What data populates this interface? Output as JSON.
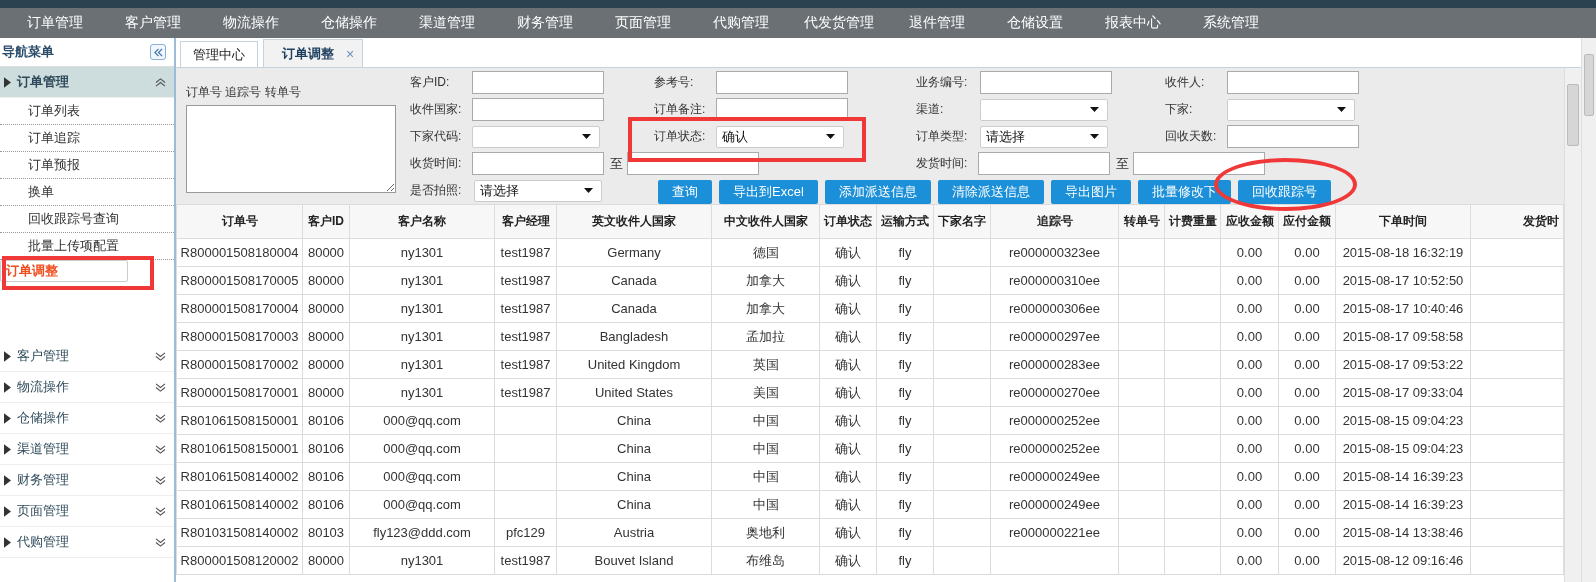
{
  "top_menu": [
    {
      "label": "订单管理"
    },
    {
      "label": "客户管理"
    },
    {
      "label": "物流操作"
    },
    {
      "label": "仓储操作"
    },
    {
      "label": "渠道管理"
    },
    {
      "label": "财务管理"
    },
    {
      "label": "页面管理"
    },
    {
      "label": "代购管理"
    },
    {
      "label": "代发货管理"
    },
    {
      "label": "退件管理"
    },
    {
      "label": "仓储设置"
    },
    {
      "label": "报表中心"
    },
    {
      "label": "系统管理"
    }
  ],
  "sidebar": {
    "title": "导航菜单",
    "groups": [
      {
        "label": "订单管理",
        "expanded": true,
        "children": [
          {
            "label": "订单列表",
            "selected": false
          },
          {
            "label": "订单追踪",
            "selected": false
          },
          {
            "label": "订单预报",
            "selected": false
          },
          {
            "label": "换单",
            "selected": false
          },
          {
            "label": "回收跟踪号查询",
            "selected": false
          },
          {
            "label": "批量上传项配置",
            "selected": false
          },
          {
            "label": "订单调整",
            "selected": true,
            "boxed": true
          }
        ]
      },
      {
        "label": "客户管理",
        "expanded": false
      },
      {
        "label": "物流操作",
        "expanded": false
      },
      {
        "label": "仓储操作",
        "expanded": false
      },
      {
        "label": "渠道管理",
        "expanded": false
      },
      {
        "label": "财务管理",
        "expanded": false
      },
      {
        "label": "页面管理",
        "expanded": false
      },
      {
        "label": "代购管理",
        "expanded": false
      }
    ]
  },
  "tabs": [
    {
      "label": "管理中心",
      "selected": false
    },
    {
      "label": "订单调整",
      "selected": true,
      "close": "×"
    }
  ],
  "filter": {
    "textarea_label": "订单号 追踪号 转单号",
    "fields": [
      {
        "kind": "input",
        "label": "客户ID:"
      },
      {
        "kind": "input",
        "label": "参考号:"
      },
      {
        "kind": "input",
        "label": "业务编号:"
      },
      {
        "kind": "input",
        "label": "收件人:"
      },
      {
        "kind": "input",
        "label": "收件国家:"
      },
      {
        "kind": "input",
        "label": "订单备注:"
      },
      {
        "kind": "select",
        "label": "渠道:"
      },
      {
        "kind": "select",
        "label": "下家:"
      },
      {
        "kind": "select",
        "label": "下家代码:"
      },
      {
        "kind": "select",
        "label": "订单状态:",
        "value": "确认",
        "boxed": true
      },
      {
        "kind": "select",
        "label": "订单类型:",
        "value": "请选择"
      },
      {
        "kind": "input",
        "label": "回收天数:"
      },
      {
        "kind": "range",
        "label": "收货时间:",
        "to": "至"
      },
      {
        "kind": "range",
        "label": "发货时间:",
        "to": "至"
      },
      {
        "kind": "select",
        "label": "是否拍照:",
        "value": "请选择"
      }
    ],
    "buttons": [
      {
        "label": "查询"
      },
      {
        "label": "导出到Excel"
      },
      {
        "label": "添加派送信息"
      },
      {
        "label": "清除派送信息"
      },
      {
        "label": "导出图片"
      },
      {
        "label": "批量修改下"
      },
      {
        "label": "回收跟踪号",
        "circled": true
      }
    ]
  },
  "table": {
    "columns": [
      "订单号",
      "客户ID",
      "客户名称",
      "客户经理",
      "英文收件人国家",
      "中文收件人国家",
      "订单状态",
      "运输方式",
      "下家名字",
      "追踪号",
      "转单号",
      "计费重量",
      "应收金额",
      "应付金额",
      "下单时间",
      "发货时"
    ],
    "rows": [
      [
        "R800001508180004",
        "80000",
        "ny1301",
        "test1987",
        "Germany",
        "德国",
        "确认",
        "fly",
        "",
        "re000000323ee",
        "",
        "",
        "0.00",
        "0.00",
        "2015-08-18 16:32:19",
        ""
      ],
      [
        "R800001508170005",
        "80000",
        "ny1301",
        "test1987",
        "Canada",
        "加拿大",
        "确认",
        "fly",
        "",
        "re000000310ee",
        "",
        "",
        "0.00",
        "0.00",
        "2015-08-17 10:52:50",
        ""
      ],
      [
        "R800001508170004",
        "80000",
        "ny1301",
        "test1987",
        "Canada",
        "加拿大",
        "确认",
        "fly",
        "",
        "re000000306ee",
        "",
        "",
        "0.00",
        "0.00",
        "2015-08-17 10:40:46",
        ""
      ],
      [
        "R800001508170003",
        "80000",
        "ny1301",
        "test1987",
        "Bangladesh",
        "孟加拉",
        "确认",
        "fly",
        "",
        "re000000297ee",
        "",
        "",
        "0.00",
        "0.00",
        "2015-08-17 09:58:58",
        ""
      ],
      [
        "R800001508170002",
        "80000",
        "ny1301",
        "test1987",
        "United Kingdom",
        "英国",
        "确认",
        "fly",
        "",
        "re000000283ee",
        "",
        "",
        "0.00",
        "0.00",
        "2015-08-17 09:53:22",
        ""
      ],
      [
        "R800001508170001",
        "80000",
        "ny1301",
        "test1987",
        "United States",
        "美国",
        "确认",
        "fly",
        "",
        "re000000270ee",
        "",
        "",
        "0.00",
        "0.00",
        "2015-08-17 09:33:04",
        ""
      ],
      [
        "R801061508150001",
        "80106",
        "000@qq.com",
        "",
        "China",
        "中国",
        "确认",
        "fly",
        "",
        "re000000252ee",
        "",
        "",
        "0.00",
        "0.00",
        "2015-08-15 09:04:23",
        ""
      ],
      [
        "R801061508150001",
        "80106",
        "000@qq.com",
        "",
        "China",
        "中国",
        "确认",
        "fly",
        "",
        "re000000252ee",
        "",
        "",
        "0.00",
        "0.00",
        "2015-08-15 09:04:23",
        ""
      ],
      [
        "R801061508140002",
        "80106",
        "000@qq.com",
        "",
        "China",
        "中国",
        "确认",
        "fly",
        "",
        "re000000249ee",
        "",
        "",
        "0.00",
        "0.00",
        "2015-08-14 16:39:23",
        ""
      ],
      [
        "R801061508140002",
        "80106",
        "000@qq.com",
        "",
        "China",
        "中国",
        "确认",
        "fly",
        "",
        "re000000249ee",
        "",
        "",
        "0.00",
        "0.00",
        "2015-08-14 16:39:23",
        ""
      ],
      [
        "R801031508140002",
        "80103",
        "fly123@ddd.com",
        "pfc129",
        "Austria",
        "奥地利",
        "确认",
        "fly",
        "",
        "re000000221ee",
        "",
        "",
        "0.00",
        "0.00",
        "2015-08-14 13:38:46",
        ""
      ],
      [
        "R800001508120002",
        "80000",
        "ny1301",
        "test1987",
        "Bouvet Island",
        "布维岛",
        "确认",
        "fly",
        "",
        "",
        "",
        "",
        "0.00",
        "0.00",
        "2015-08-12 09:16:46",
        ""
      ]
    ]
  }
}
